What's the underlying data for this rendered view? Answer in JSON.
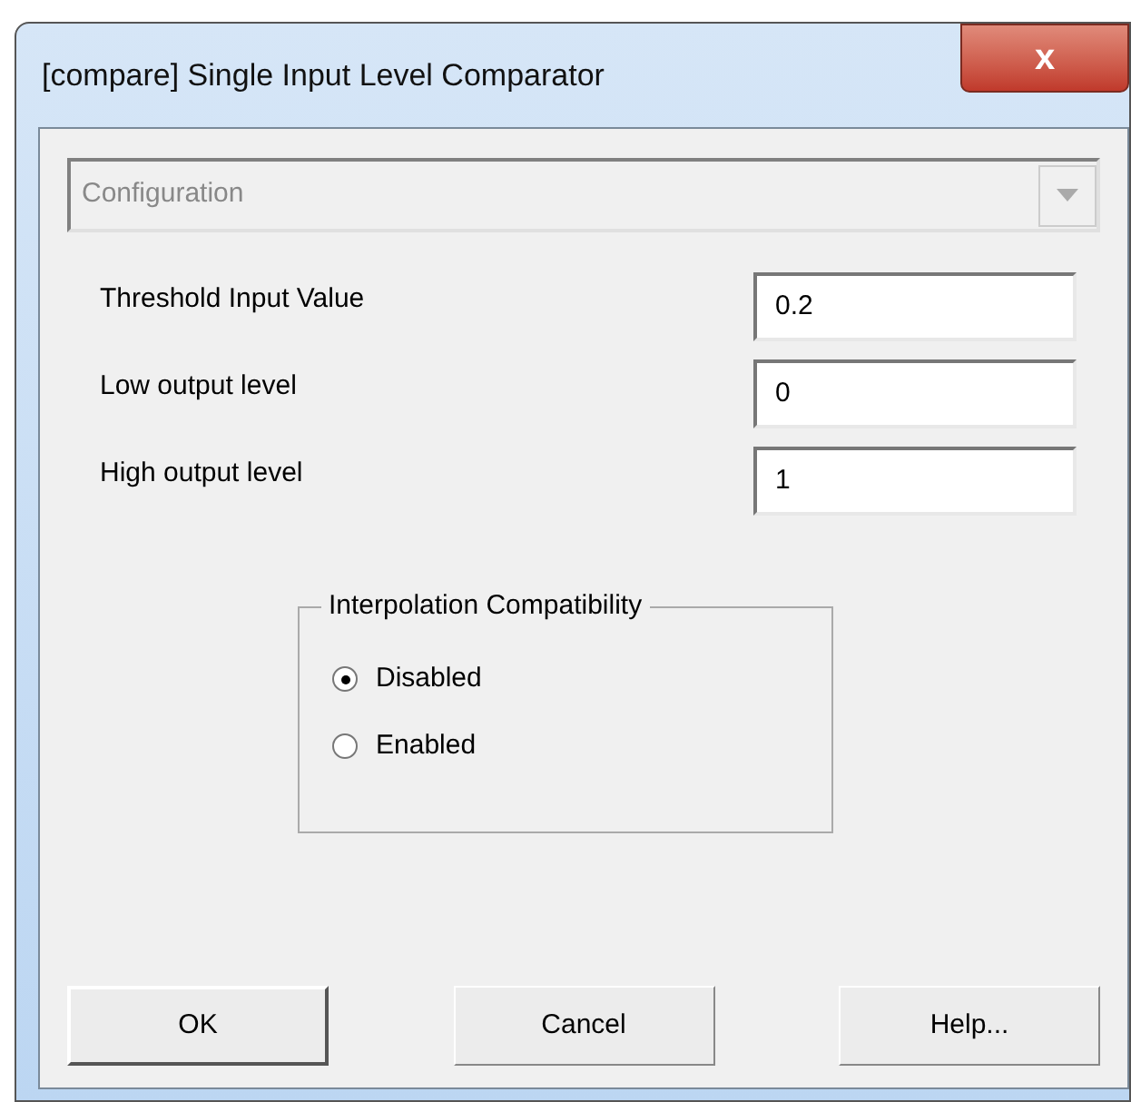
{
  "window": {
    "title": "[compare] Single Input Level Comparator",
    "close_glyph": "x"
  },
  "dropdown": {
    "value": "Configuration",
    "disabled": true
  },
  "fields": [
    {
      "label": "Threshold Input Value",
      "value": "0.2"
    },
    {
      "label": "Low output level",
      "value": "0"
    },
    {
      "label": "High output level",
      "value": "1"
    }
  ],
  "group": {
    "title": "Interpolation Compatibility",
    "options": [
      {
        "label": "Disabled",
        "selected": true
      },
      {
        "label": "Enabled",
        "selected": false
      }
    ]
  },
  "buttons": [
    {
      "label": "OK",
      "default": true
    },
    {
      "label": "Cancel",
      "default": false
    },
    {
      "label": "Help...",
      "default": false
    }
  ]
}
